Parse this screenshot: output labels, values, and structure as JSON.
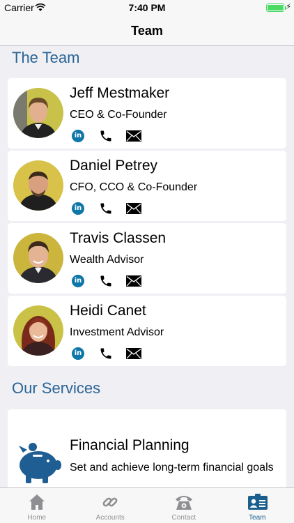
{
  "status_bar": {
    "carrier": "Carrier",
    "time": "7:40 PM"
  },
  "nav": {
    "title": "Team"
  },
  "team_section": {
    "title": "The Team",
    "members": [
      {
        "name": "Jeff Mestmaker",
        "role": "CEO & Co-Founder"
      },
      {
        "name": "Daniel Petrey",
        "role": "CFO, CCO & Co-Founder"
      },
      {
        "name": "Travis Classen",
        "role": "Wealth Advisor"
      },
      {
        "name": "Heidi Canet",
        "role": "Investment Advisor"
      }
    ],
    "linkedin_glyph": "in"
  },
  "services_section": {
    "title": "Our Services",
    "items": [
      {
        "title": "Financial Planning",
        "description": "Set and achieve long-term financial goals",
        "icon": "piggy-bank-icon"
      }
    ]
  },
  "tab_bar": {
    "tabs": [
      {
        "label": "Home",
        "icon": "home-icon"
      },
      {
        "label": "Accounts",
        "icon": "link-icon"
      },
      {
        "label": "Contact",
        "icon": "telephone-icon"
      },
      {
        "label": "Team",
        "icon": "contact-card-icon"
      }
    ],
    "active": "Team"
  },
  "colors": {
    "accent": "#2a6496",
    "tab_active": "#1b5f8f",
    "linkedin": "#0e76a8",
    "piggy": "#1e5e93",
    "battery": "#4cd964"
  }
}
